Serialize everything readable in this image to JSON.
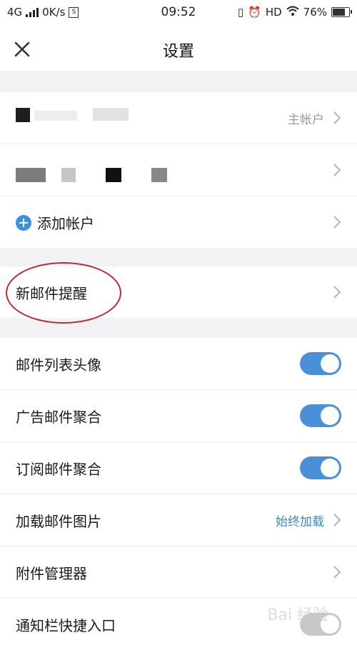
{
  "status_bar": {
    "network": "4G",
    "speed": "0K/s",
    "time": "09:52",
    "hd": "HD",
    "battery": "76%"
  },
  "header": {
    "title": "设置"
  },
  "accounts": {
    "primary_tag": "主帐户",
    "add_account_label": "添加帐户"
  },
  "new_mail": {
    "label": "新邮件提醒"
  },
  "settings": {
    "items": [
      {
        "label": "邮件列表头像",
        "type": "toggle",
        "on": true
      },
      {
        "label": "广告邮件聚合",
        "type": "toggle",
        "on": true
      },
      {
        "label": "订阅邮件聚合",
        "type": "toggle",
        "on": true
      },
      {
        "label": "加载邮件图片",
        "type": "value",
        "value": "始终加载"
      },
      {
        "label": "附件管理器",
        "type": "link"
      },
      {
        "label": "通知栏快捷入口",
        "type": "toggle",
        "on": false
      }
    ]
  },
  "colors": {
    "accent": "#4a90d9",
    "highlight": "#c0282e"
  }
}
